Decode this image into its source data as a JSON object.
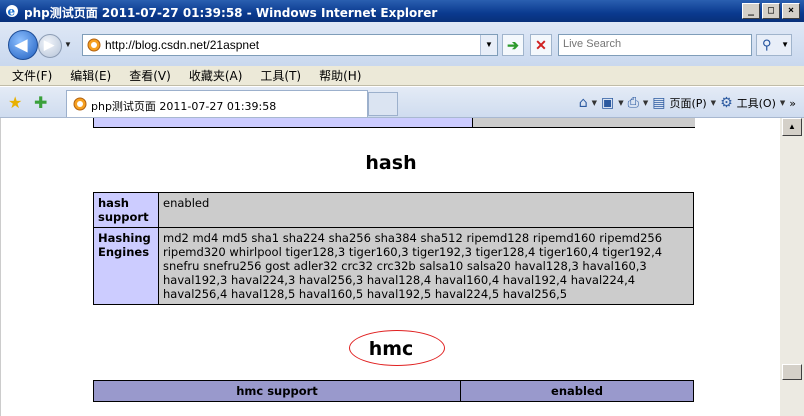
{
  "window": {
    "title": "php测试页面 2011-07-27 01:39:58 - Windows Internet Explorer",
    "buttons": [
      "_",
      "□",
      "×"
    ]
  },
  "address_bar": {
    "url": "http://blog.csdn.net/21aspnet",
    "search_placeholder": "Live Search"
  },
  "menu": [
    "文件(F)",
    "编辑(E)",
    "查看(V)",
    "收藏夹(A)",
    "工具(T)",
    "帮助(H)"
  ],
  "tab": {
    "label": "php测试页面 2011-07-27 01:39:58"
  },
  "commands": {
    "page_label": "页面(P)",
    "tools_label": "工具(O)",
    "more": "»"
  },
  "content": {
    "hash_heading": "hash",
    "hash_rows": [
      {
        "label": "hash support",
        "value": "enabled"
      },
      {
        "label": "Hashing Engines",
        "value": "md2 md4 md5 sha1 sha224 sha256 sha384 sha512 ripemd128 ripemd160 ripemd256 ripemd320 whirlpool tiger128,3 tiger160,3 tiger192,3 tiger128,4 tiger160,4 tiger192,4 snefru snefru256 gost adler32 crc32 crc32b salsa10 salsa20 haval128,3 haval160,3 haval192,3 haval224,3 haval256,3 haval128,4 haval160,4 haval192,4 haval224,4 haval256,4 haval128,5 haval160,5 haval192,5 haval224,5 haval256,5"
      }
    ],
    "hmc_heading": "hmc",
    "hmc_header": [
      "hmc support",
      "enabled"
    ]
  },
  "colors": {
    "label_cell": "#ccccff",
    "value_cell": "#cccccc",
    "header_cell": "#9999cc",
    "highlight_ellipse": "#e02020"
  }
}
